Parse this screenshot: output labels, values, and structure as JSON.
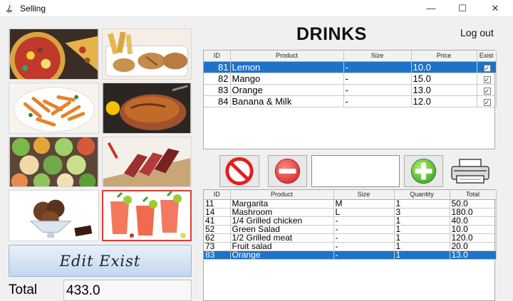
{
  "window": {
    "title": "Selling",
    "minimize_glyph": "—",
    "maximize_glyph": "☐",
    "close_glyph": "✕"
  },
  "sidebar": {
    "categories": [
      {
        "name": "pizza",
        "icon": "pizza-image"
      },
      {
        "name": "wraps",
        "icon": "wraps-image"
      },
      {
        "name": "pasta",
        "icon": "pasta-image"
      },
      {
        "name": "grilled-chicken",
        "icon": "grilled-chicken-image"
      },
      {
        "name": "salads",
        "icon": "salads-image"
      },
      {
        "name": "grilled-meat",
        "icon": "grilled-meat-image"
      },
      {
        "name": "ice-cream",
        "icon": "ice-cream-image"
      },
      {
        "name": "drinks",
        "icon": "drinks-image",
        "selected": true
      }
    ],
    "edit_exist_label": "Edit Exist",
    "total_label": "Total",
    "total_value": "433.0"
  },
  "header": {
    "category_title": "DRINKS",
    "logout_label": "Log out"
  },
  "products_table": {
    "columns": [
      "ID",
      "Product",
      "Size",
      "Price",
      "Exist"
    ],
    "rows": [
      {
        "id": "81",
        "product": "Lemon",
        "size": "-",
        "price": "10.0",
        "exist": true,
        "selected": true
      },
      {
        "id": "82",
        "product": "Mango",
        "size": "-",
        "price": "15.0",
        "exist": true
      },
      {
        "id": "83",
        "product": "Orange",
        "size": "-",
        "price": "13.0",
        "exist": true
      },
      {
        "id": "84",
        "product": "Banana & Milk",
        "size": "-",
        "price": "12.0",
        "exist": true
      }
    ]
  },
  "order_controls": {
    "cancel_icon": "cancel-icon",
    "remove_icon": "minus-icon",
    "quantity_value": "",
    "add_icon": "plus-icon",
    "print_icon": "printer-icon"
  },
  "order_table": {
    "columns": [
      "ID",
      "Product",
      "Size",
      "Quantity",
      "Total"
    ],
    "rows": [
      {
        "id": "11",
        "product": "Margarita",
        "size": "M",
        "quantity": "1",
        "total": "50.0"
      },
      {
        "id": "14",
        "product": "Mashroom",
        "size": "L",
        "quantity": "3",
        "total": "180.0"
      },
      {
        "id": "41",
        "product": "1/4 Grilled chicken",
        "size": "-",
        "quantity": "1",
        "total": "40.0"
      },
      {
        "id": "52",
        "product": "Green Salad",
        "size": "-",
        "quantity": "1",
        "total": "10.0"
      },
      {
        "id": "62",
        "product": "1/2 Grilled meat",
        "size": "-",
        "quantity": "1",
        "total": "120.0"
      },
      {
        "id": "73",
        "product": "Fruit salad",
        "size": "-",
        "quantity": "1",
        "total": "20.0"
      },
      {
        "id": "83",
        "product": "Orange",
        "size": "-",
        "quantity": "1",
        "total": "13.0",
        "selected": true
      }
    ]
  },
  "colors": {
    "selection": "#1e73c8",
    "selected_tile_border": "#e53935",
    "cancel_red": "#e02020",
    "add_green": "#3ea62c"
  }
}
